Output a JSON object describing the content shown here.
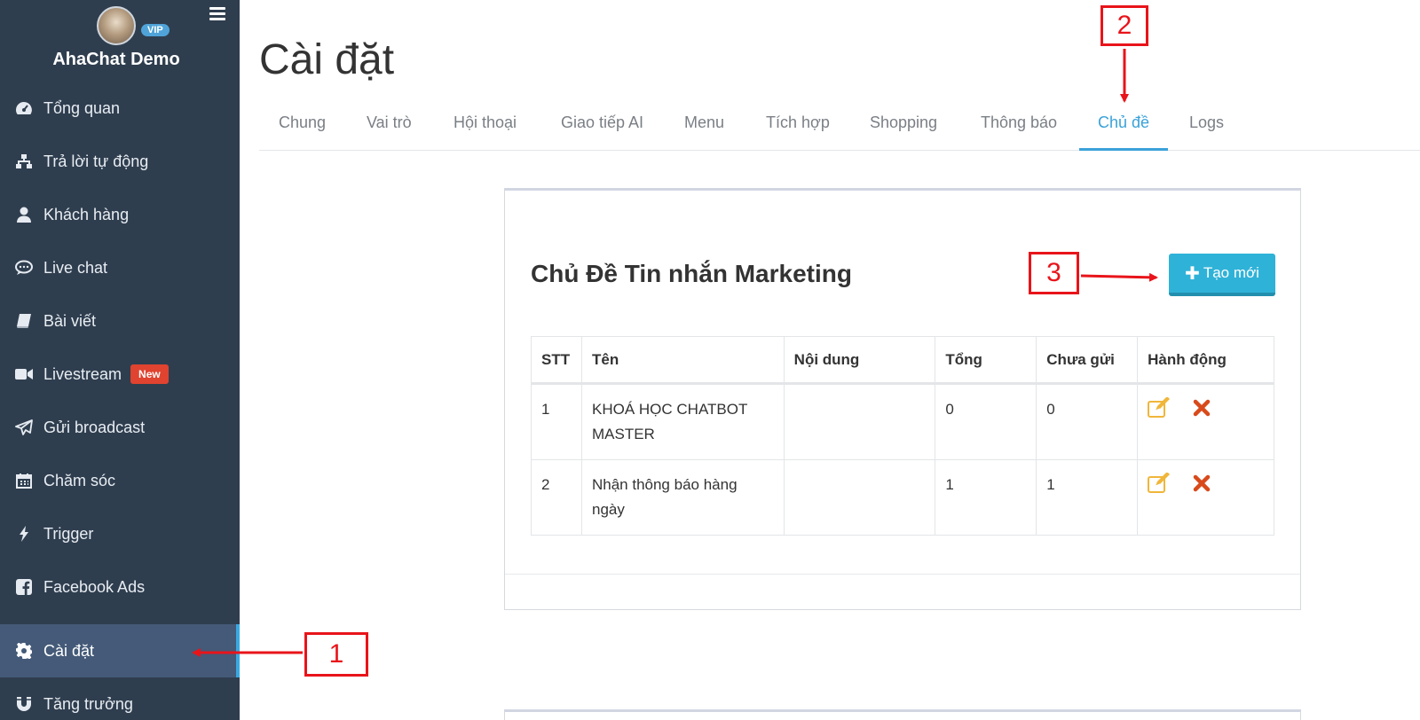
{
  "sidebar": {
    "brand": "AhaChat Demo",
    "vip_badge": "VIP",
    "items": [
      {
        "label": "Tổng quan",
        "icon": "dashboard-icon"
      },
      {
        "label": "Trả lời tự động",
        "icon": "sitemap-icon"
      },
      {
        "label": "Khách hàng",
        "icon": "user-icon"
      },
      {
        "label": "Live chat",
        "icon": "chat-bubble-icon"
      },
      {
        "label": "Bài viết",
        "icon": "book-icon"
      },
      {
        "label": "Livestream",
        "icon": "video-camera-icon",
        "badge": "New"
      },
      {
        "label": "Gửi broadcast",
        "icon": "paper-plane-icon"
      },
      {
        "label": "Chăm sóc",
        "icon": "calendar-icon"
      },
      {
        "label": "Trigger",
        "icon": "lightning-icon"
      },
      {
        "label": "Facebook Ads",
        "icon": "facebook-icon"
      },
      {
        "label": "Cài đặt",
        "icon": "gear-icon",
        "active": true
      },
      {
        "label": "Tăng trưởng",
        "icon": "magnet-icon"
      }
    ]
  },
  "main": {
    "title": "Cài đặt",
    "tabs": [
      {
        "label": "Chung"
      },
      {
        "label": "Vai trò"
      },
      {
        "label": "Hội thoại"
      },
      {
        "label": "Giao tiếp AI"
      },
      {
        "label": "Menu"
      },
      {
        "label": "Tích hợp"
      },
      {
        "label": "Shopping"
      },
      {
        "label": "Thông báo"
      },
      {
        "label": "Chủ đề",
        "active": true
      },
      {
        "label": "Logs"
      }
    ],
    "card": {
      "title": "Chủ Đề Tin nhắn Marketing",
      "create_button": "Tạo mới",
      "table": {
        "headers": [
          "STT",
          "Tên",
          "Nội dung",
          "Tổng",
          "Chưa gửi",
          "Hành động"
        ],
        "rows": [
          {
            "stt": "1",
            "name": "KHOÁ HỌC CHATBOT MASTER",
            "content": "",
            "total": "0",
            "unsent": "0"
          },
          {
            "stt": "2",
            "name": "Nhận thông báo hàng ngày",
            "content": "",
            "total": "1",
            "unsent": "1"
          }
        ]
      }
    }
  },
  "annotations": {
    "step1": "1",
    "step2": "2",
    "step3": "3"
  },
  "colors": {
    "sidebar_bg": "#2f3e4f",
    "active_item_bg": "#445a78",
    "accent": "#3aa2d8",
    "button": "#2fb2d8",
    "edit_icon": "#f0b63a",
    "delete_icon": "#d84a1b",
    "annotation": "#e8141a",
    "new_badge": "#e0432f"
  }
}
